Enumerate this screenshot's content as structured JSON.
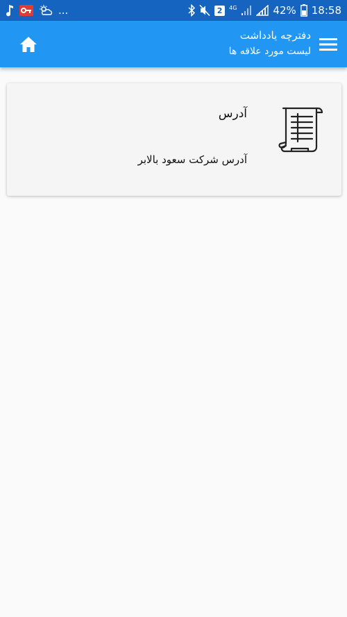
{
  "status_bar": {
    "battery_percent": "42%",
    "time": "18:58",
    "sim_badge": "2",
    "network_type": "4G",
    "overflow": "...",
    "background_color": "#1565c0"
  },
  "app_bar": {
    "title": "دفترچه یادداشت",
    "subtitle": "لیست مورد علاقه ها",
    "background_color": "#2196f3",
    "home_icon": "home-icon",
    "menu_icon": "hamburger-menu-icon"
  },
  "favorites": [
    {
      "title": "آدرس",
      "body": "آدرس شرکت سعود بالابر",
      "icon": "notebook-document-icon"
    }
  ]
}
